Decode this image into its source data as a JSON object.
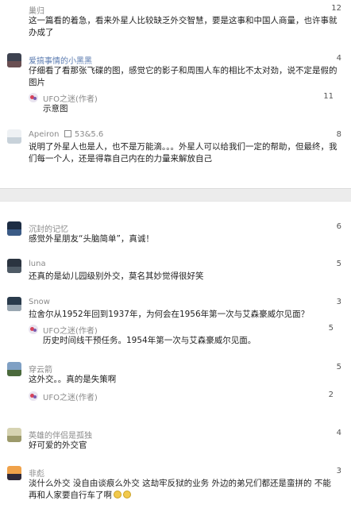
{
  "section1": {
    "comments": [
      {
        "user": "巢归",
        "likes": "12",
        "text": "这一篇看的着急，看来外星人比较缺乏外交智慧，要是这事和中国人商量，也许事就办成了"
      },
      {
        "user": "爱搞事情的小黑黑",
        "likes": "4",
        "text": "仔细看了看那张飞碟的图，感觉它的影子和周围人车的相比不太对劲，说不定是假的图片",
        "reply": {
          "user": "UFO之迷(作者)",
          "likes": "11",
          "text": "示意图"
        }
      },
      {
        "user": "Apeiron",
        "user_badge": "53&5.6",
        "likes": "8",
        "text": "说明了外星人也是人，也不是万能滴。。。外星人可以给我们一定的帮助，但最终，我们每一个人，还是得靠自己内在的力量来解放自己"
      }
    ]
  },
  "section2": {
    "comments": [
      {
        "user": "沉封的记忆",
        "likes": "6",
        "text": "感觉外星朋友“头脑简单”，真诚！"
      },
      {
        "user": "luna",
        "likes": "5",
        "text": "还真的是幼儿园级别外交，莫名其妙觉得很好笑"
      },
      {
        "user": "Snow",
        "likes": "3",
        "text": "拉舍尔从1952年回到1937年，为何会在1956年第一次与艾森豪威尔见面？",
        "reply": {
          "user": "UFO之迷(作者)",
          "likes": "5",
          "text": "历史时间线干预任务。1954年第一次与艾森豪威尔见面。"
        }
      },
      {
        "user": "穿云箭",
        "likes": "5",
        "text": "这外交。。真的是失策啊",
        "reply": {
          "user": "UFO之迷(作者)",
          "likes": "2",
          "text": ""
        }
      },
      {
        "user": "英雄的伴侣是孤独",
        "likes": "4",
        "text": "好可爱的外交官"
      },
      {
        "user": "非彪",
        "likes": "3",
        "text_line1": "淡什么外交 没自由谈痕么外交 这劫牢反狱的业务 外边的弟兄们都还是蛮拼的 不能",
        "text_line2": "再和人家要自行车了啊",
        "emoji": [
          "smile-emoji",
          "smile-emoji"
        ]
      }
    ]
  },
  "colors": {
    "username": "#8a8a8a",
    "text": "#222222",
    "divider": "#ececec"
  }
}
